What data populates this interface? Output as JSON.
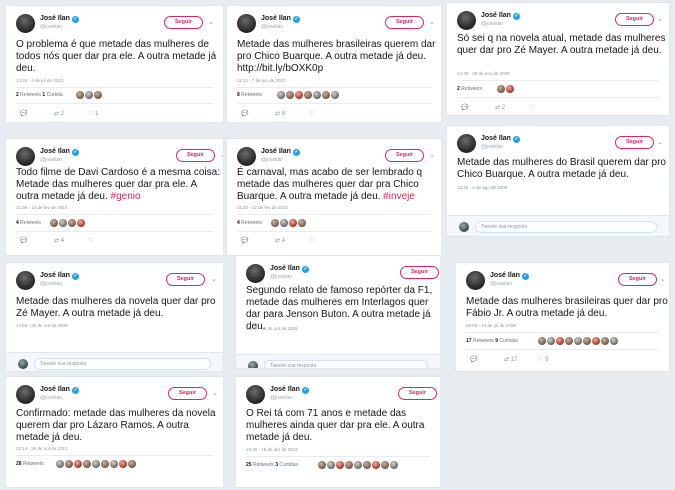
{
  "tweets": [
    {
      "name": "José Ilan",
      "handle": "@joseilan",
      "follow": "Seguir",
      "text": "O problema é que metade das mulheres de todos nós quer dar pra ele. A outra metade já deu.",
      "tag": "",
      "date": "14:48 - 4 de jul de 2013",
      "stats": {
        "retweets": "2",
        "retweets_label": "Retweets",
        "likes": "1",
        "likes_label": "Curtida"
      },
      "actions": {
        "reply": "",
        "retweet": "2",
        "like": "1"
      }
    },
    {
      "name": "José Ilan",
      "handle": "@joseilan",
      "follow": "Seguir",
      "text": "Metade das mulheres brasileiras querem dar pro Chico Buarque. A outra metade já deu. http://bit.ly/bOXK0p",
      "tag": "",
      "date": "11:22 - 7 de jun de 2010",
      "stats": {
        "retweets": "8",
        "retweets_label": "Retweets",
        "likes": "",
        "likes_label": ""
      },
      "actions": {
        "reply": "",
        "retweet": "8",
        "like": ""
      }
    },
    {
      "name": "José Ilan",
      "handle": "@joseilan",
      "follow": "Seguir",
      "text": "Só sei q na novela atual, metade das mulheres quer dar pro Zé Mayer. A outra metade já deu.",
      "tag": "",
      "date": "14:38 - 28 de nov de 2009",
      "stats": {
        "retweets": "2",
        "retweets_label": "Retweets",
        "likes": "",
        "likes_label": ""
      },
      "actions": {
        "reply": "",
        "retweet": "2",
        "like": ""
      }
    },
    {
      "name": "José Ilan",
      "handle": "@joseilan",
      "follow": "Seguir",
      "text": "Todo filme de Davi Cardoso é a mesma coisa: Metade das mulheres quer dar pra ele. A outra metade já deu.",
      "tag": "#genio",
      "date": "21:58 - 14 de fev de 2010",
      "stats": {
        "retweets": "4",
        "retweets_label": "Retweets",
        "likes": "",
        "likes_label": ""
      },
      "actions": {
        "reply": "",
        "retweet": "4",
        "like": ""
      }
    },
    {
      "name": "José Ilan",
      "handle": "@joseilan",
      "follow": "Seguir",
      "text": "É carnaval, mas acabo de ser lembrado q metade das mulheres quer dar pra Chico Buarque. A outra metade já deu.",
      "tag": "#inveje",
      "date": "11:33 - 12 de fev de 2010",
      "stats": {
        "retweets": "4",
        "retweets_label": "Retweets",
        "likes": "",
        "likes_label": ""
      },
      "actions": {
        "reply": "",
        "retweet": "4",
        "like": ""
      }
    },
    {
      "name": "José Ilan",
      "handle": "@joseilan",
      "follow": "Seguir",
      "text": "Metade das mulheres do Brasil querem dar pro Chico Buarque. A outra metade já deu.",
      "tag": "",
      "date": "13:48 - 2 de ago de 2009",
      "reply_placeholder": "Tweete sua resposta"
    },
    {
      "name": "José Ilan",
      "handle": "@joseilan",
      "follow": "Seguir",
      "text": "Metade das mulheres da novela quer dar pro Zé Mayer. A outra metade já deu.",
      "tag": "",
      "date": "14:55 - 26 de out de 2009",
      "reply_placeholder": "Tweete sua resposta"
    },
    {
      "name": "José Ilan",
      "handle": "@joseilan",
      "follow": "Seguir",
      "text": "Segundo relato de famoso repórter da F1, metade das mulheres em Interlagos quer dar para Jenson Buton. A outra metade já deu.",
      "tag": "",
      "date": "21:05 - 19 de out de 2009",
      "reply_placeholder": "Tweete sua resposta"
    },
    {
      "name": "José Ilan",
      "handle": "@joseilan",
      "follow": "Seguir",
      "text": "Metade das mulheres brasileiras quer dar pro Fábio Jr. A outra metade já deu.",
      "tag": "",
      "date": "09:03 - 14 de jul de 2009",
      "stats": {
        "retweets": "17",
        "retweets_label": "Retweets",
        "likes": "9",
        "likes_label": "Curtidas"
      },
      "actions": {
        "reply": "",
        "retweet": "17",
        "like": "9"
      }
    },
    {
      "name": "José Ilan",
      "handle": "@joseilan",
      "follow": "Seguir",
      "text": "Confirmado: metade das mulheres da novela querem dar pro Lázaro Ramos. A outra metade já deu.",
      "tag": "",
      "date": "22:14 - 29 de out de 2013",
      "stats": {
        "retweets": "28",
        "retweets_label": "Retweets",
        "likes": "",
        "likes_label": ""
      }
    },
    {
      "name": "José Ilan",
      "handle": "@joseilan",
      "follow": "Seguir",
      "text": "O Rei tá com 71 anos e metade das mulheres ainda quer dar pra ele. A outra metade já deu.",
      "tag": "",
      "date": "18:45 - 19 de abr de 2012",
      "stats": {
        "retweets": "25",
        "retweets_label": "Retweets",
        "likes": "3",
        "likes_label": "Curtidas"
      }
    }
  ],
  "icons": {
    "reply": "reply-icon",
    "retweet": "retweet-icon",
    "like": "heart-icon",
    "chevron": "chevron-down-icon",
    "verified": "verified-icon"
  },
  "colors": {
    "background": "#e6ecf0",
    "follow": "#e0245e",
    "hashtag": "#e0245e",
    "verified": "#1da1f2"
  }
}
